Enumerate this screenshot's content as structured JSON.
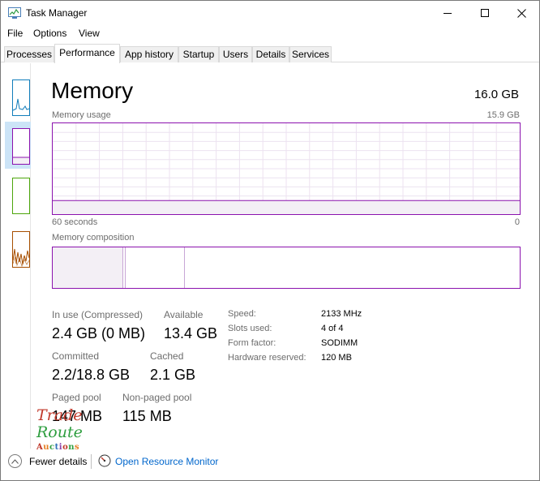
{
  "window": {
    "title": "Task Manager"
  },
  "menu": {
    "items": [
      "File",
      "Options",
      "View"
    ]
  },
  "tabs": [
    {
      "label": "Processes",
      "active": false
    },
    {
      "label": "Performance",
      "active": true
    },
    {
      "label": "App history",
      "active": false
    },
    {
      "label": "Startup",
      "active": false
    },
    {
      "label": "Users",
      "active": false
    },
    {
      "label": "Details",
      "active": false
    },
    {
      "label": "Services",
      "active": false
    }
  ],
  "memory": {
    "heading": "Memory",
    "total": "16.0 GB",
    "usage_label": "Memory usage",
    "usage_max": "15.9 GB",
    "time_left": "60 seconds",
    "time_right": "0",
    "composition_label": "Memory composition",
    "in_use_fraction": 0.15
  },
  "stats": {
    "in_use_label": "In use (Compressed)",
    "in_use_value": "2.4 GB (0 MB)",
    "available_label": "Available",
    "available_value": "13.4 GB",
    "committed_label": "Committed",
    "committed_value": "2.2/18.8 GB",
    "cached_label": "Cached",
    "cached_value": "2.1 GB",
    "paged_label": "Paged pool",
    "paged_value": "147 MB",
    "nonpaged_label": "Non-paged pool",
    "nonpaged_value": "115 MB"
  },
  "specs": {
    "speed_label": "Speed:",
    "speed_value": "2133 MHz",
    "slots_label": "Slots used:",
    "slots_value": "4 of 4",
    "form_label": "Form factor:",
    "form_value": "SODIMM",
    "reserved_label": "Hardware reserved:",
    "reserved_value": "120 MB"
  },
  "watermark": {
    "line1": "Trade",
    "line2": "Route",
    "line3": "Auctions"
  },
  "footer": {
    "fewer_details": "Fewer details",
    "resource_monitor": "Open Resource Monitor"
  },
  "colors": {
    "memory_accent": "#8b12ae",
    "cpu_accent": "#117dbb",
    "disk_accent": "#4da60c",
    "ethernet_accent": "#a74f01",
    "link": "#0066cc",
    "selection": "#cce4f7"
  }
}
